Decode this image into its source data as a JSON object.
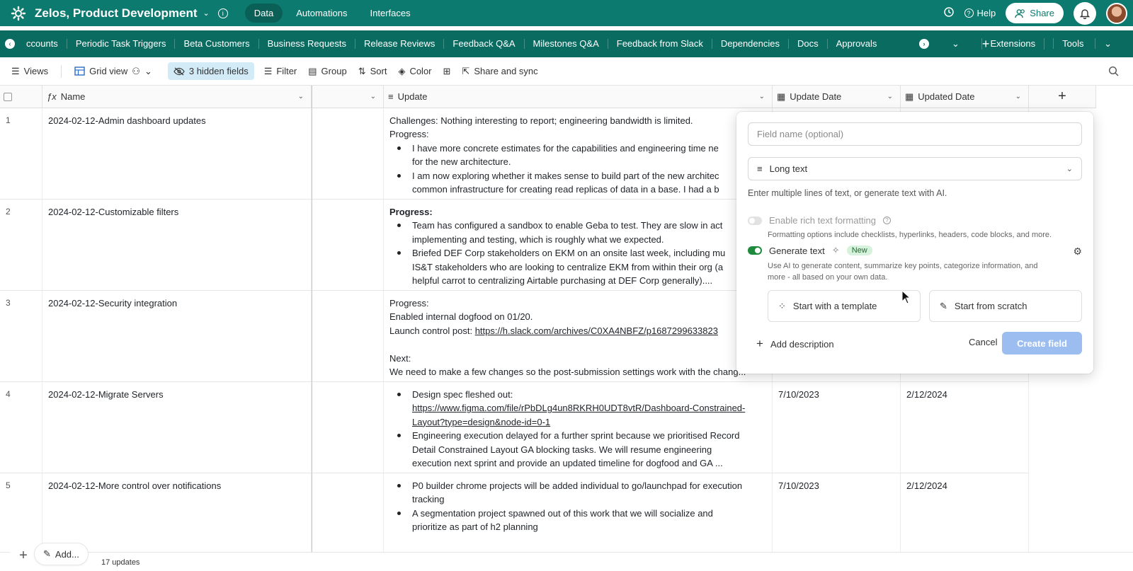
{
  "topbar": {
    "base_name": "Zelos, Product Development",
    "nav": [
      "Data",
      "Automations",
      "Interfaces"
    ],
    "active_nav": "Data",
    "help_label": "Help",
    "share_label": "Share"
  },
  "tabs": {
    "items": [
      "ccounts",
      "Periodic Task Triggers",
      "Beta Customers",
      "Business Requests",
      "Release Reviews",
      "Feedback Q&A",
      "Milestones Q&A",
      "Feedback from Slack",
      "Dependencies",
      "Docs",
      "Approvals"
    ],
    "extensions_label": "Extensions",
    "tools_label": "Tools"
  },
  "toolbar": {
    "views_label": "Views",
    "grid_view_label": "Grid view",
    "hidden_fields_label": "3 hidden fields",
    "filter_label": "Filter",
    "group_label": "Group",
    "sort_label": "Sort",
    "color_label": "Color",
    "share_sync_label": "Share and sync"
  },
  "columns": {
    "name": "Name",
    "update": "Update",
    "update_date": "Update Date",
    "updated_date": "Updated Date"
  },
  "rows": [
    {
      "num": "1",
      "name": "2024-02-12-Admin dashboard updates",
      "lines": [
        "Challenges: Nothing interesting to report; engineering bandwidth is limited.",
        "Progress:"
      ],
      "bullets": [
        "I have more concrete estimates for the capabilities and engineering time ne",
        "for the new architecture.",
        "I am now exploring whether it makes sense to build part of the new architec",
        "common infrastructure for creating read replicas of data in a base. I had a b"
      ],
      "update_date": "",
      "updated_date": ""
    },
    {
      "num": "2",
      "name": "2024-02-12-Customizable filters",
      "heading": "Progress:",
      "bullets": [
        "Team has configured a sandbox to enable Geba to test. They are slow in act",
        "implementing and testing, which is roughly what we expected.",
        "Briefed DEF Corp stakeholders on EKM on an onsite last week, including mu",
        "IS&T stakeholders who are looking to centralize EKM from within their org (a",
        "helpful carrot to centralizing Airtable purchasing at DEF Corp generally)...."
      ],
      "update_date": "",
      "updated_date": ""
    },
    {
      "num": "3",
      "name": "2024-02-12-Security integration",
      "lines": [
        "Progress:",
        "Enabled internal dogfood on 01/20.",
        "Launch control post: ",
        "",
        "Next:",
        "We need to make a few changes so the post-submission settings work with the chang..."
      ],
      "link": "https://h.slack.com/archives/C0XA4NBFZ/p1687299633823",
      "update_date": "",
      "updated_date": ""
    },
    {
      "num": "4",
      "name": "2024-02-12-Migrate Servers",
      "bullets": [
        "Design spec fleshed out:",
        "https://www.figma.com/file/rPbDLg4un8RKRH0UDT8vtR/Dashboard-Constrained-",
        "Layout?type=design&node-id=0-1",
        "Engineering execution delayed for a further sprint because we prioritised Record",
        "Detail Constrained Layout GA blocking tasks. We will resume engineering",
        "execution next sprint and provide an updated timeline for dogfood and GA ..."
      ],
      "update_date": "7/10/2023",
      "updated_date": "2/12/2024"
    },
    {
      "num": "5",
      "name": "2024-02-12-More control over notifications",
      "bullets": [
        "P0 builder chrome projects will be added individual to go/launchpad for execution",
        "tracking",
        "A segmentation project spawned out of this work that we will socialize and",
        "prioritize as part of h2 planning"
      ],
      "update_date": "7/10/2023",
      "updated_date": "2/12/2024"
    }
  ],
  "footer": {
    "add_label": "Add...",
    "count_label": "17 updates"
  },
  "popover": {
    "field_name_placeholder": "Field name (optional)",
    "field_type": "Long text",
    "hint": "Enter multiple lines of text, or generate text with AI.",
    "rich_text_label": "Enable rich text formatting",
    "rich_text_sub": "Formatting options include checklists, hyperlinks, headers, code blocks, and more.",
    "rich_text_enabled": false,
    "generate_label": "Generate text",
    "generate_enabled": true,
    "new_badge": "New",
    "generate_sub_1": "Use AI to generate content, summarize key points, categorize information, and",
    "generate_sub_2": "more - all based on your own data.",
    "template_label": "Start with a template",
    "scratch_label": "Start from scratch",
    "add_description_label": "Add description",
    "cancel_label": "Cancel",
    "create_label": "Create field"
  },
  "colors": {
    "topbar": "#0d7a6f",
    "tabbar": "#0a6b61",
    "create_button": "#9bbdf0",
    "hidden_fields_bg": "#d2ebf7"
  }
}
